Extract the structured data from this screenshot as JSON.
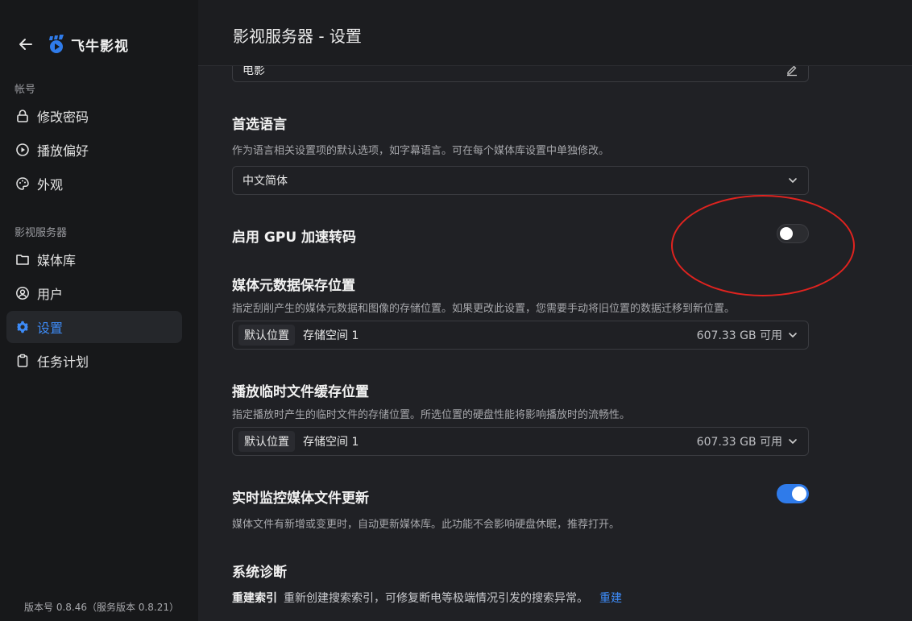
{
  "header": {
    "title": "影视服务器 - 设置"
  },
  "brand": {
    "name": "飞牛影视",
    "accent": "#2f7bea"
  },
  "sidebar": {
    "account_label": "帐号",
    "server_label": "影视服务器",
    "account_items": [
      {
        "label": "修改密码",
        "icon": "lock-icon"
      },
      {
        "label": "播放偏好",
        "icon": "play-circle-icon"
      },
      {
        "label": "外观",
        "icon": "palette-icon"
      }
    ],
    "server_items": [
      {
        "label": "媒体库",
        "icon": "folder-icon"
      },
      {
        "label": "用户",
        "icon": "user-icon"
      },
      {
        "label": "设置",
        "icon": "gear-icon",
        "active": true
      },
      {
        "label": "任务计划",
        "icon": "clipboard-icon"
      }
    ],
    "version": "版本号 0.8.46（服务版本 0.8.21）"
  },
  "settings": {
    "library_name_value": "电影",
    "preferred_language": {
      "title": "首选语言",
      "desc": "作为语言相关设置项的默认选项，如字幕语言。可在每个媒体库设置中单独修改。",
      "value": "中文简体"
    },
    "gpu": {
      "title": "启用 GPU 加速转码",
      "enabled": false
    },
    "metadata_location": {
      "title": "媒体元数据保存位置",
      "desc": "指定刮削产生的媒体元数据和图像的存储位置。如果更改此设置，您需要手动将旧位置的数据迁移到新位置。",
      "tag": "默认位置",
      "storage": "存储空间 1",
      "available": "607.33 GB 可用"
    },
    "cache_location": {
      "title": "播放临时文件缓存位置",
      "desc": "指定播放时产生的临时文件的存储位置。所选位置的硬盘性能将影响播放时的流畅性。",
      "tag": "默认位置",
      "storage": "存储空间 1",
      "available": "607.33 GB 可用"
    },
    "realtime_monitor": {
      "title": "实时监控媒体文件更新",
      "desc": "媒体文件有新增或变更时，自动更新媒体库。此功能不会影响硬盘休眠，推荐打开。",
      "enabled": true
    },
    "diagnostics": {
      "title": "系统诊断",
      "rebuild_label": "重建索引",
      "rebuild_desc": "重新创建搜索索引，可修复断电等极端情况引发的搜索异常。",
      "rebuild_link": "重建"
    }
  }
}
